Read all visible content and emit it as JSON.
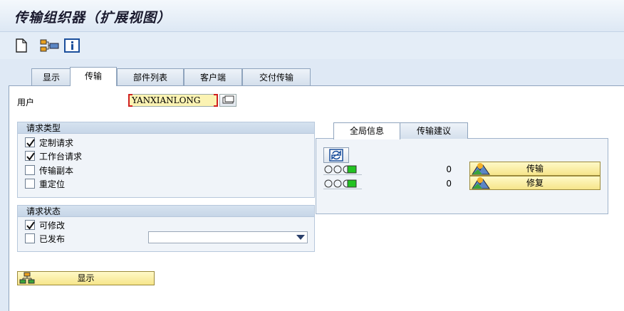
{
  "window": {
    "title": "传输组织器（扩展视图）"
  },
  "toolbar": {
    "buttons": [
      {
        "icon": "new-document-icon"
      },
      {
        "icon": "transport-tree-icon"
      },
      {
        "icon": "info-icon"
      }
    ]
  },
  "tabs": [
    "显示",
    "传输",
    "部件列表",
    "客户端",
    "交付传输"
  ],
  "active_tab": "传输",
  "user": {
    "label": "用户",
    "value": "YANXIANLONG"
  },
  "request_type": {
    "title": "请求类型",
    "items": [
      {
        "label": "定制请求",
        "checked": true
      },
      {
        "label": "工作台请求",
        "checked": true
      },
      {
        "label": "传输副本",
        "checked": false
      },
      {
        "label": "重定位",
        "checked": false
      }
    ]
  },
  "request_status": {
    "title": "请求状态",
    "items": [
      {
        "label": "可修改",
        "checked": true
      },
      {
        "label": "已发布",
        "checked": false
      }
    ],
    "release_dropdown": ""
  },
  "display_button": {
    "label": "显示"
  },
  "right_tabs": [
    "全局信息",
    "传输建议"
  ],
  "right_active_tab": "全局信息",
  "right_rows": [
    {
      "count": "0",
      "button": "传输"
    },
    {
      "count": "0",
      "button": "修复"
    }
  ],
  "colors": {
    "accent": "#dfe9f5",
    "button_yellow": "#f6e58a",
    "light_green": "#22c322"
  }
}
